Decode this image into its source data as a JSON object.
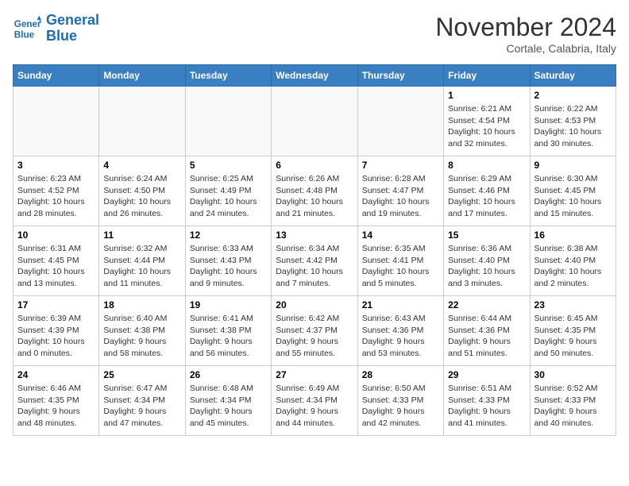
{
  "header": {
    "logo_line1": "General",
    "logo_line2": "Blue",
    "month": "November 2024",
    "location": "Cortale, Calabria, Italy"
  },
  "weekdays": [
    "Sunday",
    "Monday",
    "Tuesday",
    "Wednesday",
    "Thursday",
    "Friday",
    "Saturday"
  ],
  "weeks": [
    [
      {
        "day": "",
        "info": ""
      },
      {
        "day": "",
        "info": ""
      },
      {
        "day": "",
        "info": ""
      },
      {
        "day": "",
        "info": ""
      },
      {
        "day": "",
        "info": ""
      },
      {
        "day": "1",
        "info": "Sunrise: 6:21 AM\nSunset: 4:54 PM\nDaylight: 10 hours\nand 32 minutes."
      },
      {
        "day": "2",
        "info": "Sunrise: 6:22 AM\nSunset: 4:53 PM\nDaylight: 10 hours\nand 30 minutes."
      }
    ],
    [
      {
        "day": "3",
        "info": "Sunrise: 6:23 AM\nSunset: 4:52 PM\nDaylight: 10 hours\nand 28 minutes."
      },
      {
        "day": "4",
        "info": "Sunrise: 6:24 AM\nSunset: 4:50 PM\nDaylight: 10 hours\nand 26 minutes."
      },
      {
        "day": "5",
        "info": "Sunrise: 6:25 AM\nSunset: 4:49 PM\nDaylight: 10 hours\nand 24 minutes."
      },
      {
        "day": "6",
        "info": "Sunrise: 6:26 AM\nSunset: 4:48 PM\nDaylight: 10 hours\nand 21 minutes."
      },
      {
        "day": "7",
        "info": "Sunrise: 6:28 AM\nSunset: 4:47 PM\nDaylight: 10 hours\nand 19 minutes."
      },
      {
        "day": "8",
        "info": "Sunrise: 6:29 AM\nSunset: 4:46 PM\nDaylight: 10 hours\nand 17 minutes."
      },
      {
        "day": "9",
        "info": "Sunrise: 6:30 AM\nSunset: 4:45 PM\nDaylight: 10 hours\nand 15 minutes."
      }
    ],
    [
      {
        "day": "10",
        "info": "Sunrise: 6:31 AM\nSunset: 4:45 PM\nDaylight: 10 hours\nand 13 minutes."
      },
      {
        "day": "11",
        "info": "Sunrise: 6:32 AM\nSunset: 4:44 PM\nDaylight: 10 hours\nand 11 minutes."
      },
      {
        "day": "12",
        "info": "Sunrise: 6:33 AM\nSunset: 4:43 PM\nDaylight: 10 hours\nand 9 minutes."
      },
      {
        "day": "13",
        "info": "Sunrise: 6:34 AM\nSunset: 4:42 PM\nDaylight: 10 hours\nand 7 minutes."
      },
      {
        "day": "14",
        "info": "Sunrise: 6:35 AM\nSunset: 4:41 PM\nDaylight: 10 hours\nand 5 minutes."
      },
      {
        "day": "15",
        "info": "Sunrise: 6:36 AM\nSunset: 4:40 PM\nDaylight: 10 hours\nand 3 minutes."
      },
      {
        "day": "16",
        "info": "Sunrise: 6:38 AM\nSunset: 4:40 PM\nDaylight: 10 hours\nand 2 minutes."
      }
    ],
    [
      {
        "day": "17",
        "info": "Sunrise: 6:39 AM\nSunset: 4:39 PM\nDaylight: 10 hours\nand 0 minutes."
      },
      {
        "day": "18",
        "info": "Sunrise: 6:40 AM\nSunset: 4:38 PM\nDaylight: 9 hours\nand 58 minutes."
      },
      {
        "day": "19",
        "info": "Sunrise: 6:41 AM\nSunset: 4:38 PM\nDaylight: 9 hours\nand 56 minutes."
      },
      {
        "day": "20",
        "info": "Sunrise: 6:42 AM\nSunset: 4:37 PM\nDaylight: 9 hours\nand 55 minutes."
      },
      {
        "day": "21",
        "info": "Sunrise: 6:43 AM\nSunset: 4:36 PM\nDaylight: 9 hours\nand 53 minutes."
      },
      {
        "day": "22",
        "info": "Sunrise: 6:44 AM\nSunset: 4:36 PM\nDaylight: 9 hours\nand 51 minutes."
      },
      {
        "day": "23",
        "info": "Sunrise: 6:45 AM\nSunset: 4:35 PM\nDaylight: 9 hours\nand 50 minutes."
      }
    ],
    [
      {
        "day": "24",
        "info": "Sunrise: 6:46 AM\nSunset: 4:35 PM\nDaylight: 9 hours\nand 48 minutes."
      },
      {
        "day": "25",
        "info": "Sunrise: 6:47 AM\nSunset: 4:34 PM\nDaylight: 9 hours\nand 47 minutes."
      },
      {
        "day": "26",
        "info": "Sunrise: 6:48 AM\nSunset: 4:34 PM\nDaylight: 9 hours\nand 45 minutes."
      },
      {
        "day": "27",
        "info": "Sunrise: 6:49 AM\nSunset: 4:34 PM\nDaylight: 9 hours\nand 44 minutes."
      },
      {
        "day": "28",
        "info": "Sunrise: 6:50 AM\nSunset: 4:33 PM\nDaylight: 9 hours\nand 42 minutes."
      },
      {
        "day": "29",
        "info": "Sunrise: 6:51 AM\nSunset: 4:33 PM\nDaylight: 9 hours\nand 41 minutes."
      },
      {
        "day": "30",
        "info": "Sunrise: 6:52 AM\nSunset: 4:33 PM\nDaylight: 9 hours\nand 40 minutes."
      }
    ]
  ]
}
